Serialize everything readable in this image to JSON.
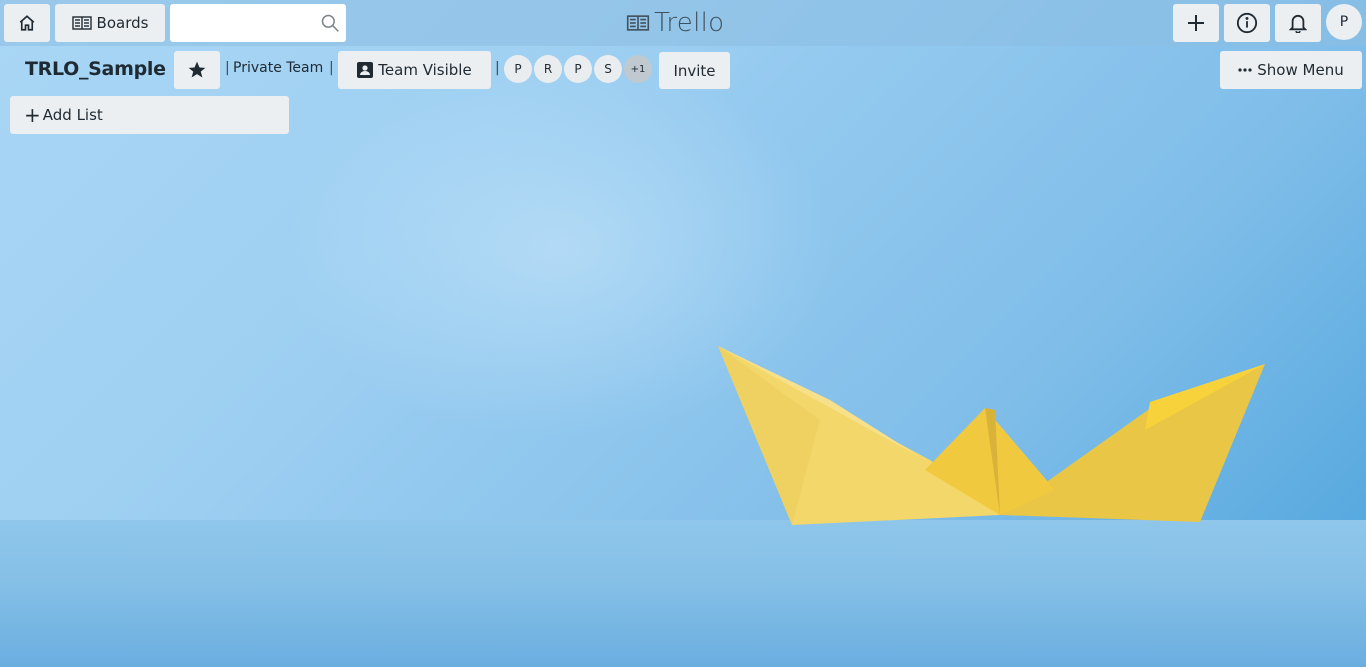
{
  "header": {
    "home_icon": "home-icon",
    "boards_label": "Boards",
    "search": {
      "value": "",
      "placeholder": ""
    },
    "logo_text": "Trello",
    "avatar_initial": "P"
  },
  "board": {
    "title": "TRLO_Sample",
    "team_name": "Private Team",
    "visibility_label": "Team Visible",
    "members": [
      "P",
      "R",
      "P",
      "S"
    ],
    "more_members": "+1",
    "invite_label": "Invite",
    "show_menu_label": "Show Menu"
  },
  "lists": {
    "add_list_label": "Add List"
  },
  "colors": {
    "button_bg": "#eceff1",
    "boat_yellow": "#f2d45c"
  }
}
